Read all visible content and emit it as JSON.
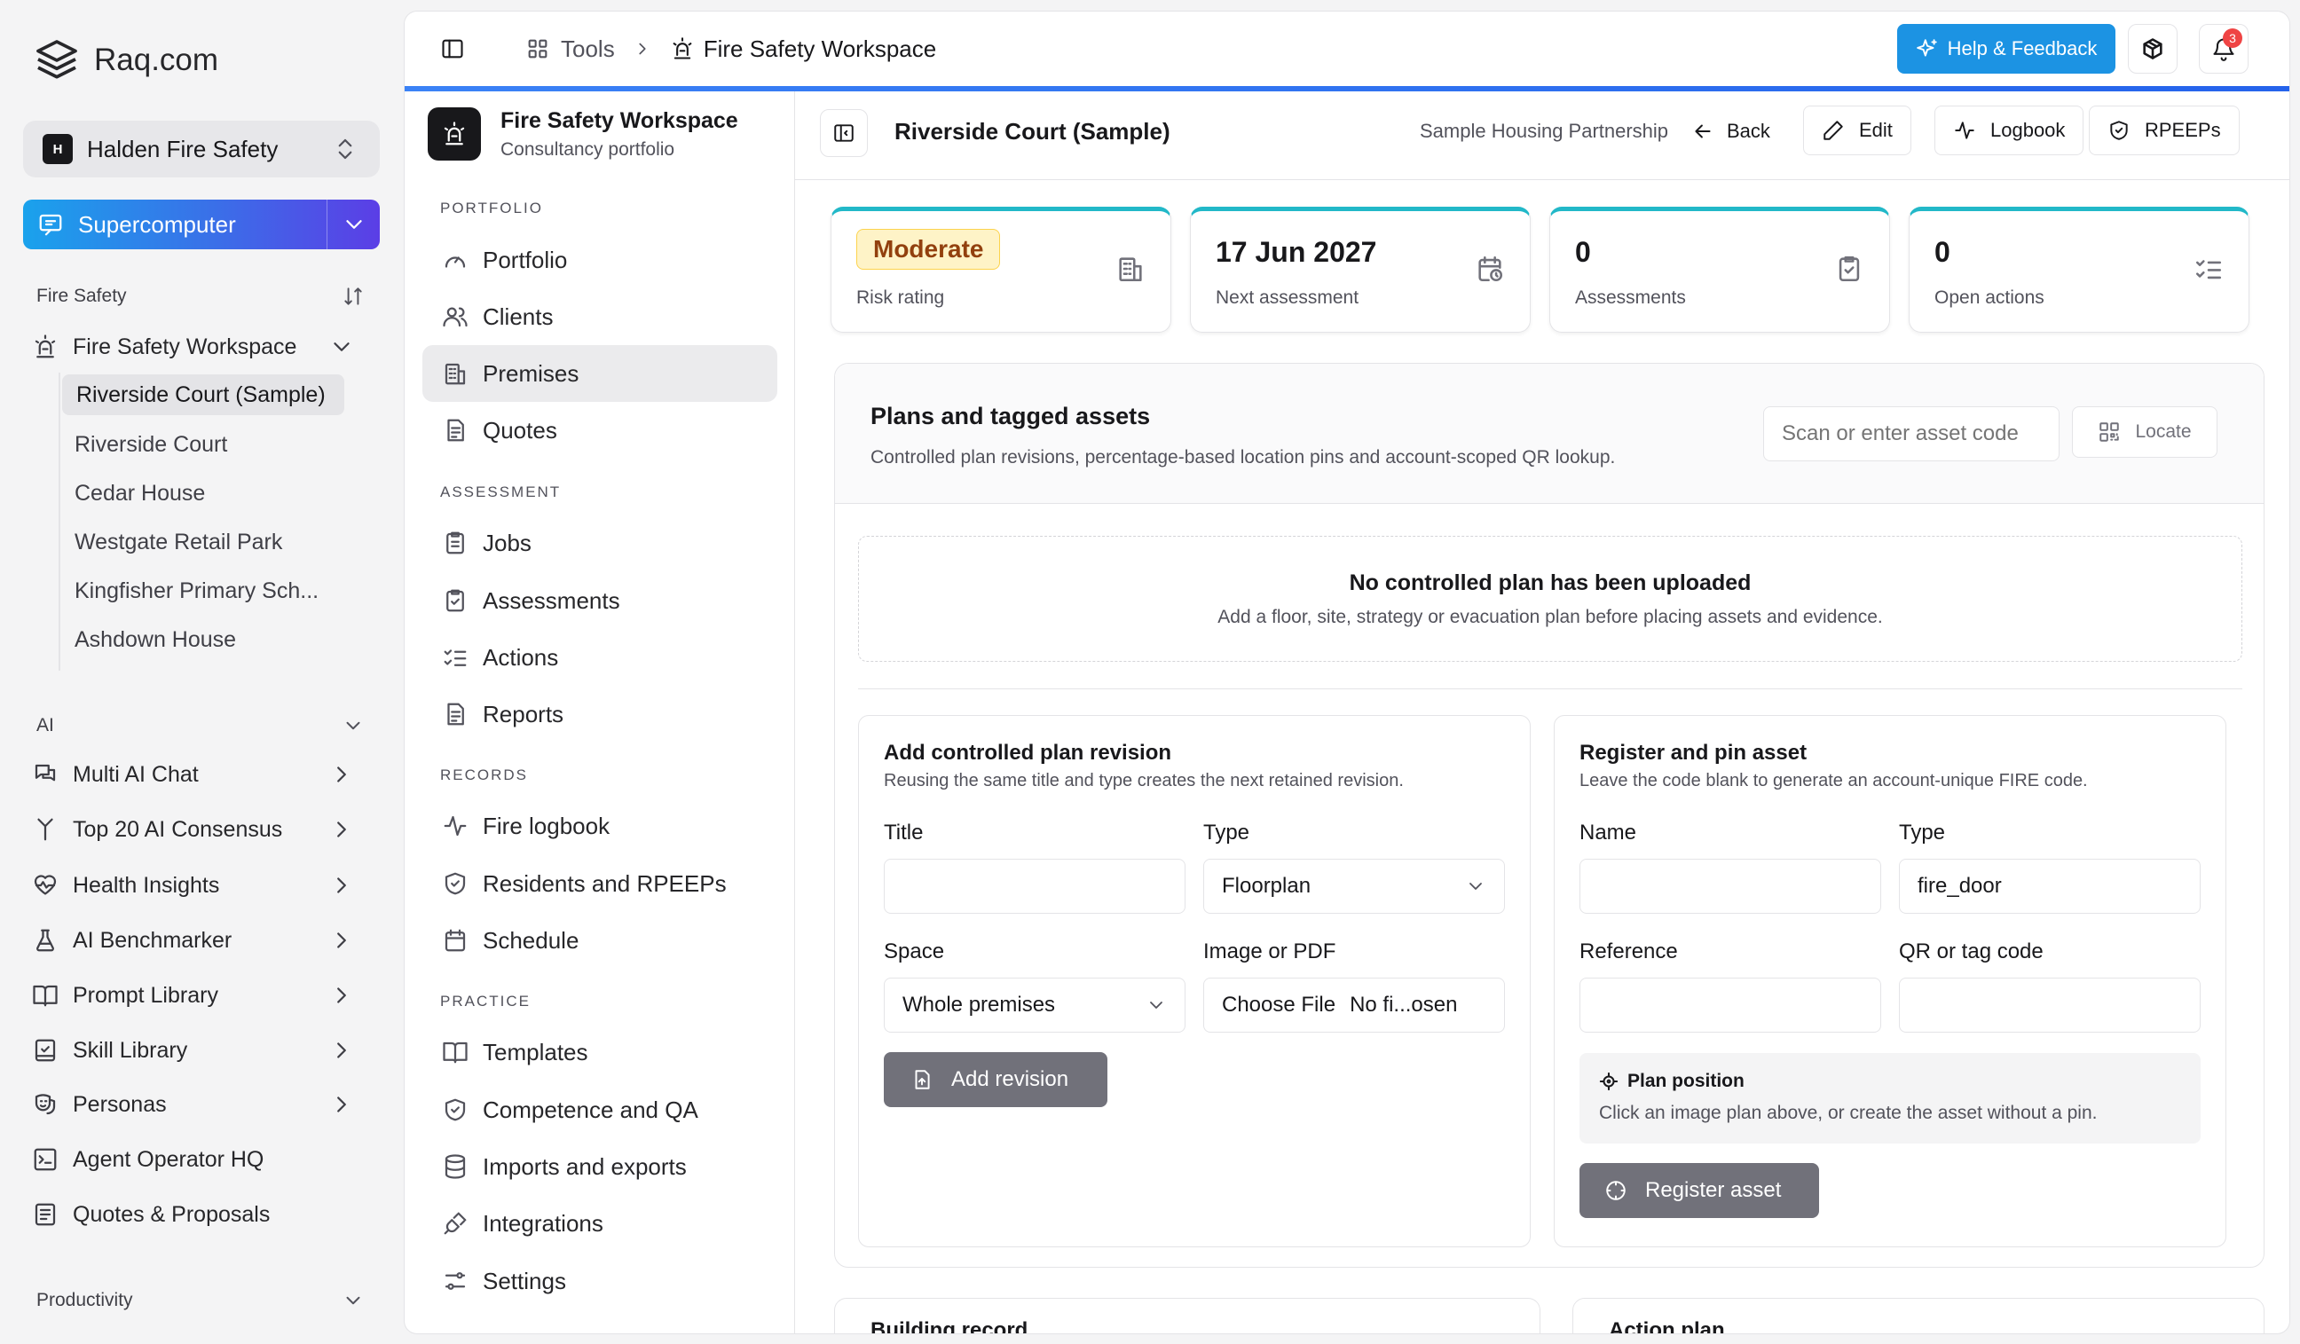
{
  "brand": {
    "name": "Raq.com"
  },
  "org": {
    "initial": "H",
    "name": "Halden Fire Safety"
  },
  "supercomputer": {
    "label": "Supercomputer"
  },
  "sidebar": {
    "fire_section": "Fire Safety",
    "workspace_label": "Fire Safety Workspace",
    "premises": [
      "Riverside Court (Sample)",
      "Riverside Court",
      "Cedar House",
      "Westgate Retail Park",
      "Kingfisher Primary Sch...",
      "Ashdown House"
    ],
    "ai_section": "AI",
    "ai_items": [
      "Multi AI Chat",
      "Top 20 AI Consensus",
      "Health Insights",
      "AI Benchmarker",
      "Prompt Library",
      "Skill Library",
      "Personas",
      "Agent Operator HQ",
      "Quotes & Proposals"
    ],
    "productivity_section": "Productivity"
  },
  "topbar": {
    "tools": "Tools",
    "workspace": "Fire Safety Workspace",
    "help": "Help & Feedback",
    "notifications": "3"
  },
  "workspace": {
    "title": "Fire Safety Workspace",
    "subtitle": "Consultancy portfolio",
    "groups": {
      "portfolio": "PORTFOLIO",
      "assessment": "ASSESSMENT",
      "records": "RECORDS",
      "practice": "PRACTICE"
    },
    "items": {
      "portfolio": "Portfolio",
      "clients": "Clients",
      "premises": "Premises",
      "quotes": "Quotes",
      "jobs": "Jobs",
      "assessments": "Assessments",
      "actions": "Actions",
      "reports": "Reports",
      "logbook": "Fire logbook",
      "residents": "Residents and RPEEPs",
      "schedule": "Schedule",
      "templates": "Templates",
      "competence": "Competence and QA",
      "imports": "Imports and exports",
      "integrations": "Integrations",
      "settings": "Settings"
    }
  },
  "header": {
    "title": "Riverside Court (Sample)",
    "client": "Sample Housing Partnership",
    "back": "Back",
    "edit": "Edit",
    "logbook": "Logbook",
    "rpeeps": "RPEEPs"
  },
  "stats": {
    "risk": {
      "value": "Moderate",
      "label": "Risk rating"
    },
    "next": {
      "value": "17 Jun 2027",
      "label": "Next assessment"
    },
    "assessments": {
      "value": "0",
      "label": "Assessments"
    },
    "actions": {
      "value": "0",
      "label": "Open actions"
    }
  },
  "plans": {
    "title": "Plans and tagged assets",
    "subtitle": "Controlled plan revisions, percentage-based location pins and account-scoped QR lookup.",
    "scan_placeholder": "Scan or enter asset code",
    "locate": "Locate",
    "empty_title": "No controlled plan has been uploaded",
    "empty_sub": "Add a floor, site, strategy or evacuation plan before placing assets and evidence."
  },
  "revision_form": {
    "title": "Add controlled plan revision",
    "subtitle": "Reusing the same title and type creates the next retained revision.",
    "title_label": "Title",
    "title_value": "",
    "type_label": "Type",
    "type_value": "Floorplan",
    "space_label": "Space",
    "space_value": "Whole premises",
    "file_label": "Image or PDF",
    "file_button": "Choose File",
    "file_status": "No fi...osen",
    "submit": "Add revision"
  },
  "asset_form": {
    "title": "Register and pin asset",
    "subtitle": "Leave the code blank to generate an account-unique FIRE code.",
    "name_label": "Name",
    "name_value": "",
    "type_label": "Type",
    "type_value": "fire_door",
    "reference_label": "Reference",
    "reference_value": "",
    "code_label": "QR or tag code",
    "code_value": "",
    "position_title": "Plan position",
    "position_hint": "Click an image plan above, or create the asset without a pin.",
    "submit": "Register asset"
  },
  "lower_cards": {
    "left": "Building record",
    "right": "Action plan"
  },
  "colors": {
    "accent": "#1c93e3",
    "stat_top": "#22b8c8",
    "risk_bg": "#fef3c7",
    "risk_text": "#92400e"
  }
}
